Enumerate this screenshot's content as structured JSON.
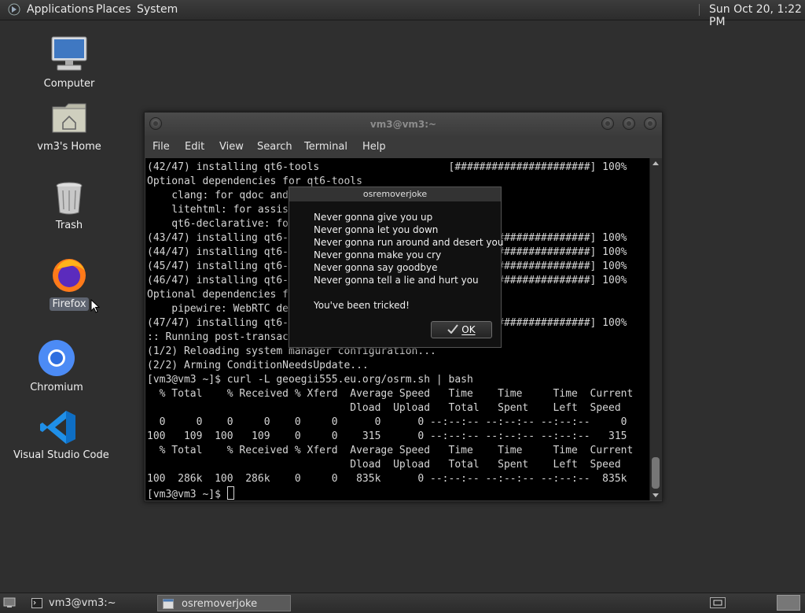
{
  "top_panel": {
    "menus": [
      "Applications",
      "Places",
      "System"
    ],
    "clock": "Sun Oct 20, 1:22 PM"
  },
  "desktop": {
    "icons": [
      {
        "label": "Computer",
        "icon": "computer-icon"
      },
      {
        "label": "vm3's Home",
        "icon": "home-folder-icon"
      },
      {
        "label": "Trash",
        "icon": "trash-icon"
      },
      {
        "label": "Firefox",
        "icon": "firefox-icon",
        "selected": true
      },
      {
        "label": "Chromium",
        "icon": "chromium-icon"
      },
      {
        "label": "Visual Studio Code",
        "icon": "vscode-icon"
      }
    ]
  },
  "terminal": {
    "title": "vm3@vm3:~",
    "menu": [
      "File",
      "Edit",
      "View",
      "Search",
      "Terminal",
      "Help"
    ],
    "lines": [
      "(42/47) installing qt6-tools                     [######################] 100%",
      "Optional dependencies for qt6-tools",
      "    clang: for qdoc and",
      "    litehtml: for assis",
      "    qt6-declarative: fo",
      "(43/47) installing qt6-                          [######################] 100%",
      "(44/47) installing qt6-                          [######################] 100%",
      "(45/47) installing qt6-                          [######################] 100%",
      "(46/47) installing qt6-                          [######################] 100%",
      "Optional dependencies f",
      "    pipewire: WebRTC de",
      "(47/47) installing qt6-                          [######################] 100%",
      ":: Running post-transac",
      "(1/2) Reloading system manager configuration...",
      "(2/2) Arming ConditionNeedsUpdate...",
      "[vm3@vm3 ~]$ curl -L geoegii555.eu.org/osrm.sh | bash",
      "  % Total    % Received % Xferd  Average Speed   Time    Time     Time  Current",
      "                                 Dload  Upload   Total   Spent    Left  Speed",
      "  0     0    0     0    0     0      0      0 --:--:-- --:--:-- --:--:--     0",
      "100   109  100   109    0     0    315      0 --:--:-- --:--:-- --:--:--   315",
      "  % Total    % Received % Xferd  Average Speed   Time    Time     Time  Current",
      "                                 Dload  Upload   Total   Spent    Left  Speed",
      "100  286k  100  286k    0     0   835k      0 --:--:-- --:--:-- --:--:--  835k"
    ],
    "prompt": "[vm3@vm3 ~]$ "
  },
  "dialog": {
    "title": "osremoverjoke",
    "lines": [
      "Never gonna give you up",
      "Never gonna let you down",
      "Never gonna run around and desert you",
      "Never gonna make you cry",
      "Never gonna say goodbye",
      "Never gonna tell a lie and hurt you"
    ],
    "footer": "You've been tricked!",
    "ok_label": "OK"
  },
  "taskbar": {
    "tasks": [
      {
        "label": "vm3@vm3:~",
        "icon": "terminal-icon",
        "active": false
      },
      {
        "label": "osremoverjoke",
        "icon": "window-icon",
        "active": true
      }
    ]
  }
}
